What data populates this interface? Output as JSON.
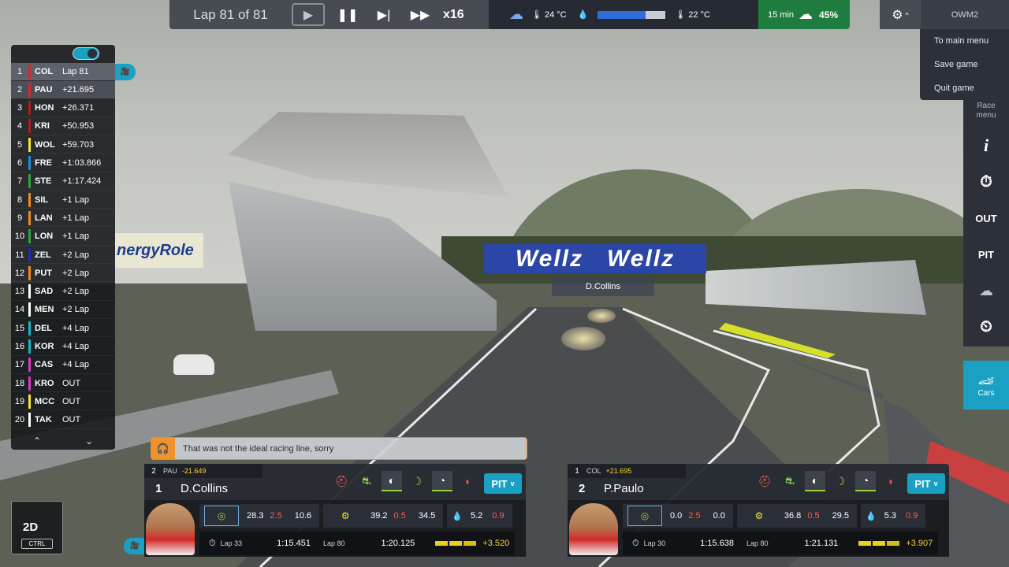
{
  "topbar": {
    "lap_text": "Lap 81 of 81",
    "speed": "x16",
    "weather": {
      "track_temp": "24 °C",
      "air_temp": "22 °C",
      "forecast_time": "15 min",
      "rain_chance": "45%"
    }
  },
  "menu": {
    "profile": "OWM2",
    "items": [
      "To main menu",
      "Save game",
      "Quit game"
    ],
    "side": {
      "race_menu_line1": "Race",
      "race_menu_line2": "menu",
      "info": "i",
      "out": "OUT",
      "pit": "PIT",
      "cars": "Cars"
    }
  },
  "standings": [
    {
      "pos": "1",
      "code": "COL",
      "gap": "Lap 81",
      "color": "#d8262b"
    },
    {
      "pos": "2",
      "code": "PAU",
      "gap": "+21.695",
      "color": "#d8262b"
    },
    {
      "pos": "3",
      "code": "HON",
      "gap": "+26.371",
      "color": "#b01a1a"
    },
    {
      "pos": "4",
      "code": "KRI",
      "gap": "+50.953",
      "color": "#b01a1a"
    },
    {
      "pos": "5",
      "code": "WOL",
      "gap": "+59.703",
      "color": "#f1e338"
    },
    {
      "pos": "6",
      "code": "FRE",
      "gap": "+1:03.866",
      "color": "#1a8fd6"
    },
    {
      "pos": "7",
      "code": "STE",
      "gap": "+1:17.424",
      "color": "#2fa33a"
    },
    {
      "pos": "8",
      "code": "SIL",
      "gap": "+1 Lap",
      "color": "#f08a1e"
    },
    {
      "pos": "9",
      "code": "LAN",
      "gap": "+1 Lap",
      "color": "#f08a1e"
    },
    {
      "pos": "10",
      "code": "LON",
      "gap": "+1 Lap",
      "color": "#2fa33a"
    },
    {
      "pos": "11",
      "code": "ZEL",
      "gap": "+2 Lap",
      "color": "#1b2fa8"
    },
    {
      "pos": "12",
      "code": "PUT",
      "gap": "+2 Lap",
      "color": "#f08a1e"
    },
    {
      "pos": "13",
      "code": "SAD",
      "gap": "+2 Lap",
      "color": "#ffffff"
    },
    {
      "pos": "14",
      "code": "MEN",
      "gap": "+2 Lap",
      "color": "#ffffff"
    },
    {
      "pos": "15",
      "code": "DEL",
      "gap": "+4 Lap",
      "color": "#19b4c9"
    },
    {
      "pos": "16",
      "code": "KOR",
      "gap": "+4 Lap",
      "color": "#19b4c9"
    },
    {
      "pos": "17",
      "code": "CAS",
      "gap": "+4 Lap",
      "color": "#d83ac8"
    },
    {
      "pos": "18",
      "code": "KRO",
      "gap": "OUT",
      "color": "#d83ac8"
    },
    {
      "pos": "19",
      "code": "MCC",
      "gap": "OUT",
      "color": "#f1e338"
    },
    {
      "pos": "20",
      "code": "TAK",
      "gap": "OUT",
      "color": "#ffffff"
    }
  ],
  "scene": {
    "banner": "Wellz",
    "energy_banner": "nergyRole",
    "driver_tag": "D.Collins"
  },
  "view2d": {
    "label": "2D",
    "key": "CTRL"
  },
  "radio": {
    "message": "That was not the ideal racing line, sorry"
  },
  "cards": [
    {
      "ahead_pos": "2",
      "ahead_code": "PAU",
      "ahead_gap": "-21.649",
      "position": "1",
      "name": "D.Collins",
      "pit": "PIT",
      "eng_a": "28.3",
      "eng_b": "2.5",
      "eng_c": "10.6",
      "tyre_a": "39.2",
      "tyre_b": "0.5",
      "tyre_c": "34.5",
      "fuel_a": "5.2",
      "fuel_b": "0.9",
      "lap_cur_label": "Lap 33",
      "lap_cur_time": "1:15.451",
      "lap_best_label": "Lap 80",
      "lap_best_time": "1:20.125",
      "delta": "+3.520"
    },
    {
      "ahead_pos": "1",
      "ahead_code": "COL",
      "ahead_gap": "+21.695",
      "position": "2",
      "name": "P.Paulo",
      "pit": "PIT",
      "eng_a": "0.0",
      "eng_b": "2.5",
      "eng_c": "0.0",
      "tyre_a": "36.8",
      "tyre_b": "0.5",
      "tyre_c": "29.5",
      "fuel_a": "5.3",
      "fuel_b": "0.9",
      "lap_cur_label": "Lap 30",
      "lap_cur_time": "1:15.638",
      "lap_best_label": "Lap 80",
      "lap_best_time": "1:21.131",
      "delta": "+3.907"
    }
  ]
}
